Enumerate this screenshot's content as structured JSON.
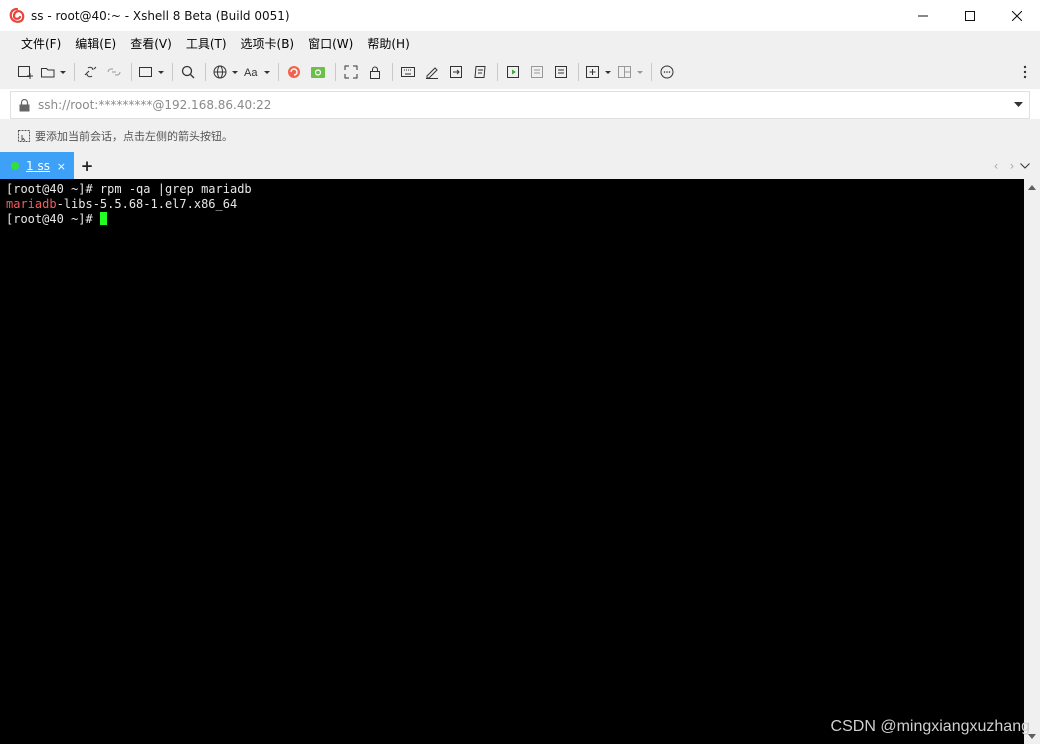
{
  "window": {
    "title": "ss - root@40:~ - Xshell 8 Beta (Build 0051)"
  },
  "menu": [
    "文件(F)",
    "编辑(E)",
    "查看(V)",
    "工具(T)",
    "选项卡(B)",
    "窗口(W)",
    "帮助(H)"
  ],
  "address": {
    "value": "ssh://root:*********@192.168.86.40:22"
  },
  "hint": {
    "text": "要添加当前会话，点击左侧的箭头按钮。"
  },
  "tab": {
    "label": "1 ss",
    "close": "×",
    "add": "+"
  },
  "tab_nav": {
    "prev": "‹",
    "next": "›",
    "menu": "⌄"
  },
  "terminal": {
    "lines": [
      {
        "prefix": "",
        "highlight": "",
        "text": "[root@40 ~]# rpm -qa |grep mariadb"
      },
      {
        "prefix": "",
        "highlight": "mariadb",
        "text": "-libs-5.5.68-1.el7.x86_64"
      },
      {
        "prefix": "",
        "highlight": "",
        "text": "[root@40 ~]# "
      }
    ]
  },
  "watermark": "CSDN @mingxiangxuzhang",
  "colors": {
    "tab_active": "#3da1f7",
    "terminal_bg": "#000000",
    "cursor": "#22ff22",
    "highlight": "#f75c5c",
    "status_dot": "#35e035"
  }
}
